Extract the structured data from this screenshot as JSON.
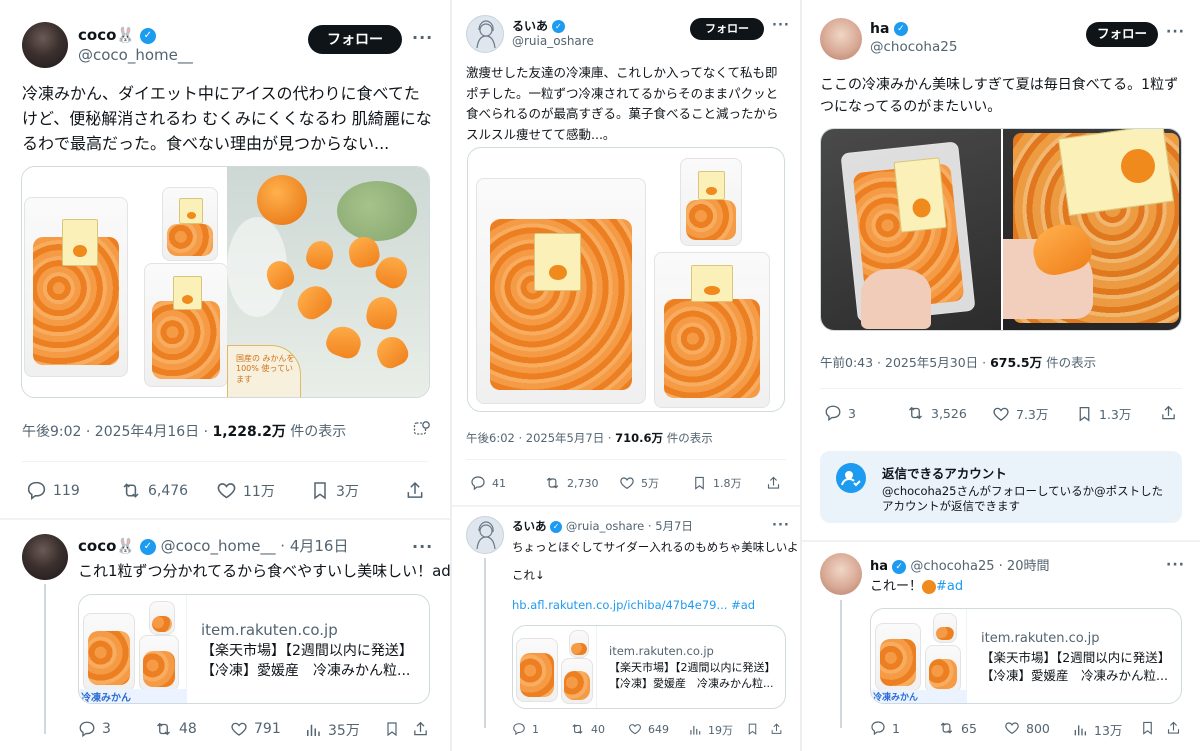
{
  "post1": {
    "name": "coco🐰",
    "handle": "@coco_home__",
    "follow": "フォロー",
    "text": "冷凍みかん、ダイエット中にアイスの代わりに食べてたけど、便秘解消されるわ むくみにくくなるわ 肌綺麗になるわで最高だった。食べない理由が見つからない...",
    "image_badge": "国産の みかんを100% 使っています",
    "time": "午後9:02 · 2025年4月16日 · ",
    "views": "1,228.2万",
    "views_suffix": " 件の表示",
    "replies": "119",
    "reposts": "6,476",
    "likes": "11万",
    "bookmarks": "3万"
  },
  "reply1": {
    "name": "coco🐰",
    "handle": "@coco_home__",
    "date": "· 4月16日",
    "text": "これ1粒ずつ分かれてるから食べやすいし美味しい！ad",
    "card_domain": "item.rakuten.co.jp",
    "card_title1": "【楽天市場】【2週間以内に発送】",
    "card_title2": "【冷凍】愛媛産　冷凍みかん粒...",
    "thumb_text": "冷凍みかん",
    "replies": "3",
    "reposts": "48",
    "likes": "791",
    "views": "35万"
  },
  "post2": {
    "name": "るいあ",
    "handle": "@ruia_oshare",
    "follow": "フォロー",
    "text": "激痩せした友達の冷凍庫、これしか入ってなくて私も即ポチした。一粒ずつ冷凍されてるからそのままパクッと食べられるのが最高すぎる。菓子食べること減ったからスルスル痩せてて感動...。",
    "time": "午後6:02 · 2025年5月7日 · ",
    "views": "710.6万",
    "views_suffix": " 件の表示",
    "replies": "41",
    "reposts": "2,730",
    "likes": "5万",
    "bookmarks": "1.8万"
  },
  "reply2": {
    "name": "るいあ",
    "handle": "@ruia_oshare",
    "date": "· 5月7日",
    "text": "ちょっとほぐしてサイダー入れるのもめちゃ美味しいよ！",
    "text2": "これ↓",
    "link": "hb.afl.rakuten.co.jp/ichiba/47b4e79...",
    "hashtag": "#ad",
    "card_domain": "item.rakuten.co.jp",
    "card_title1": "【楽天市場】【2週間以内に発送】",
    "card_title2": "【冷凍】愛媛産　冷凍みかん粒...",
    "replies": "1",
    "reposts": "40",
    "likes": "649",
    "views": "19万"
  },
  "post3": {
    "name": "ha",
    "handle": "@chocoha25",
    "follow": "フォロー",
    "text": "ここの冷凍みかん美味しすぎて夏は毎日食べてる。1粒ずつになってるのがまたいい。",
    "time": "午前0:43 · 2025年5月30日 · ",
    "views": "675.5万",
    "views_suffix": " 件の表示",
    "replies": "3",
    "reposts": "3,526",
    "likes": "7.3万",
    "bookmarks": "1.3万"
  },
  "reply_notice": {
    "title": "返信できるアカウント",
    "body": "@chocoha25さんがフォローしているか@ポストしたアカウントが返信できます"
  },
  "reply3": {
    "name": "ha",
    "handle": "@chocoha25",
    "date": "· 20時間",
    "text": "これー！",
    "hashtag": "#ad",
    "card_domain": "item.rakuten.co.jp",
    "card_title1": "【楽天市場】【2週間以内に発送】",
    "card_title2": "【冷凍】愛媛産　冷凍みかん粒...",
    "thumb_text": "冷凍みかん",
    "replies": "1",
    "reposts": "65",
    "likes": "800",
    "views": "13万"
  },
  "colors": {
    "verified": "#1d9bf0",
    "text": "#0f1419",
    "muted": "#536471",
    "link": "#1d9bf0"
  },
  "icons": [
    "reply-icon",
    "repost-icon",
    "like-icon",
    "bookmark-icon",
    "share-icon",
    "views-icon",
    "verified-icon",
    "more-icon",
    "translate-icon",
    "person-check-icon"
  ]
}
